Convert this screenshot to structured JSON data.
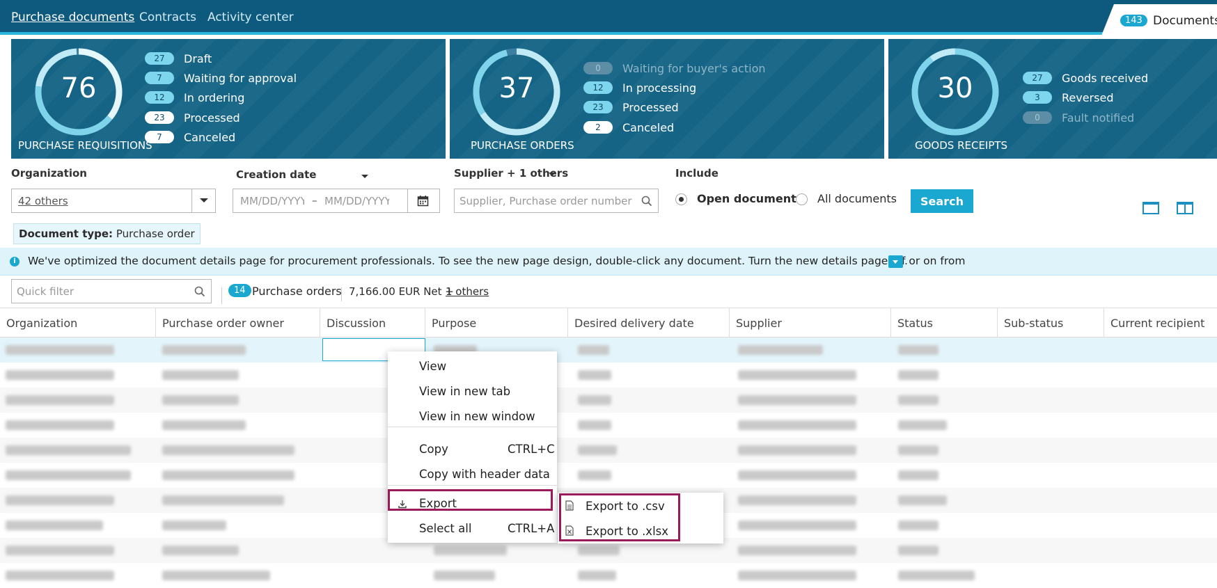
{
  "nav": {
    "tabs": [
      "Purchase documents",
      "Contracts",
      "Activity center"
    ],
    "documents_count": "143",
    "documents_label": "Documents"
  },
  "summary": {
    "requisitions": {
      "total": "76",
      "title": "PURCHASE REQUISITIONS",
      "rows": [
        {
          "count": "27",
          "label": "Draft"
        },
        {
          "count": "7",
          "label": "Waiting for approval"
        },
        {
          "count": "12",
          "label": "In ordering"
        },
        {
          "count": "23",
          "label": "Processed"
        },
        {
          "count": "7",
          "label": "Canceled"
        }
      ]
    },
    "orders": {
      "total": "37",
      "title": "PURCHASE ORDERS",
      "rows": [
        {
          "count": "0",
          "label": "Waiting for buyer's action"
        },
        {
          "count": "12",
          "label": "In processing"
        },
        {
          "count": "23",
          "label": "Processed"
        },
        {
          "count": "2",
          "label": "Canceled"
        }
      ]
    },
    "receipts": {
      "total": "30",
      "title": "GOODS RECEIPTS",
      "rows": [
        {
          "count": "27",
          "label": "Goods received"
        },
        {
          "count": "3",
          "label": "Reversed"
        },
        {
          "count": "0",
          "label": "Fault notified"
        }
      ]
    }
  },
  "filters": {
    "organization_label": "Organization",
    "organization_value": "42 others",
    "creation_date_label": "Creation date",
    "date_from_placeholder": "MM/DD/YYYY",
    "date_to_placeholder": "MM/DD/YYYY",
    "date_dash": "–",
    "supplier_label": "Supplier + 1 others",
    "supplier_placeholder": "Supplier, Purchase order number",
    "include_label": "Include",
    "open_docs": "Open documents",
    "all_docs": "All documents",
    "search_button": "Search",
    "doc_type_key": "Document type:",
    "doc_type_value": "Purchase order"
  },
  "banner": {
    "text": "We've optimized the document details page for procurement professionals. To see the new page design, double-click any document. Turn the new details page off or on from",
    "end": "."
  },
  "toolbar": {
    "quick_filter_placeholder": "Quick filter",
    "count": "14",
    "count_label": "Purchase orders",
    "total": "7,166.00 EUR Net +",
    "others_link": "1 others"
  },
  "columns": [
    "Organization",
    "Purchase order owner",
    "Discussion",
    "Purpose",
    "Desired delivery date",
    "Supplier",
    "Status",
    "Sub-status",
    "Current recipient"
  ],
  "context_menu": {
    "view": "View",
    "view_new_tab": "View in new tab",
    "view_new_window": "View in new window",
    "copy": "Copy",
    "copy_shortcut": "CTRL+C",
    "copy_header": "Copy with header data",
    "export": "Export",
    "select_all": "Select all",
    "select_all_shortcut": "CTRL+A"
  },
  "export_submenu": {
    "csv": "Export to .csv",
    "xlsx": "Export to .xlsx"
  },
  "colors": {
    "nav_bg": "#0e5a7e",
    "card_bg": "#156486",
    "accent": "#1aa7d0",
    "highlight": "#9b1a5c"
  }
}
